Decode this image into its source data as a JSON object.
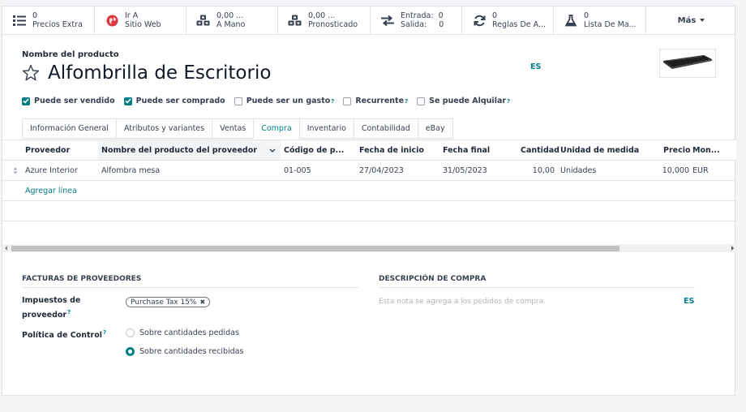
{
  "smart_buttons": [
    {
      "value": "0",
      "label": "Precios Extra",
      "icon": "list-icon"
    },
    {
      "value": "Ir A",
      "label": "Sitio Web",
      "icon": "globe-icon"
    },
    {
      "value": "0,00 ...",
      "label": "A Mano",
      "icon": "cubes-icon"
    },
    {
      "value": "0,00 ...",
      "label": "Pronosticado",
      "icon": "cubes-icon"
    },
    {
      "value": "Entrada:  0",
      "label": "Salida:     0",
      "icon": "exchange-icon"
    },
    {
      "value": "0",
      "label": "Reglas De A...",
      "icon": "refresh-icon"
    },
    {
      "value": "0",
      "label": "Lista De Ma...",
      "icon": "flask-icon"
    }
  ],
  "more_label": "Más",
  "product": {
    "name_label": "Nombre del producto",
    "name": "Alfombrilla de Escritorio",
    "lang": "ES"
  },
  "checkboxes": [
    {
      "label": "Puede ser vendido",
      "checked": true,
      "help": ""
    },
    {
      "label": "Puede ser comprado",
      "checked": true,
      "help": ""
    },
    {
      "label": "Puede ser un gasto",
      "checked": false,
      "help": "?"
    },
    {
      "label": "Recurrente",
      "checked": false,
      "help": "?"
    },
    {
      "label": "Se puede Alquilar",
      "checked": false,
      "help": "?"
    }
  ],
  "tabs": [
    "Información General",
    "Atributos y variantes",
    "Ventas",
    "Compra",
    "Inventario",
    "Contabilidad",
    "eBay"
  ],
  "active_tab": "Compra",
  "vendor_table": {
    "columns": [
      "Proveedor",
      "Nombre del producto del proveedor",
      "Código de p...",
      "Fecha de inicio",
      "Fecha final",
      "Cantidad",
      "Unidad de medida",
      "Precio",
      "Mon..."
    ],
    "rows": [
      [
        "Azure Interior",
        "Alfombra mesa",
        "01-005",
        "27/04/2023",
        "31/05/2023",
        "10,00",
        "Unidades",
        "10,000",
        "EUR"
      ]
    ],
    "add_line": "Agregar línea"
  },
  "vendor_bills": {
    "title": "FACTURAS DE PROVEEDORES",
    "taxes_label_1": "Impuestos de",
    "taxes_label_2": "proveedor",
    "taxes_help": "?",
    "tax_tag": "Purchase Tax 15%",
    "control_label": "Política de Control",
    "control_help": "?",
    "options": [
      {
        "label": "Sobre cantidades pedidas",
        "selected": false
      },
      {
        "label": "Sobre cantidades recibidas",
        "selected": true
      }
    ]
  },
  "purchase_description": {
    "title": "DESCRIPCIÓN DE COMPRA",
    "placeholder": "Esta nota se agrega a los pedidos de compra.",
    "lang": "ES"
  },
  "colors": {
    "accent": "#017e84",
    "border": "#dee2e6"
  }
}
